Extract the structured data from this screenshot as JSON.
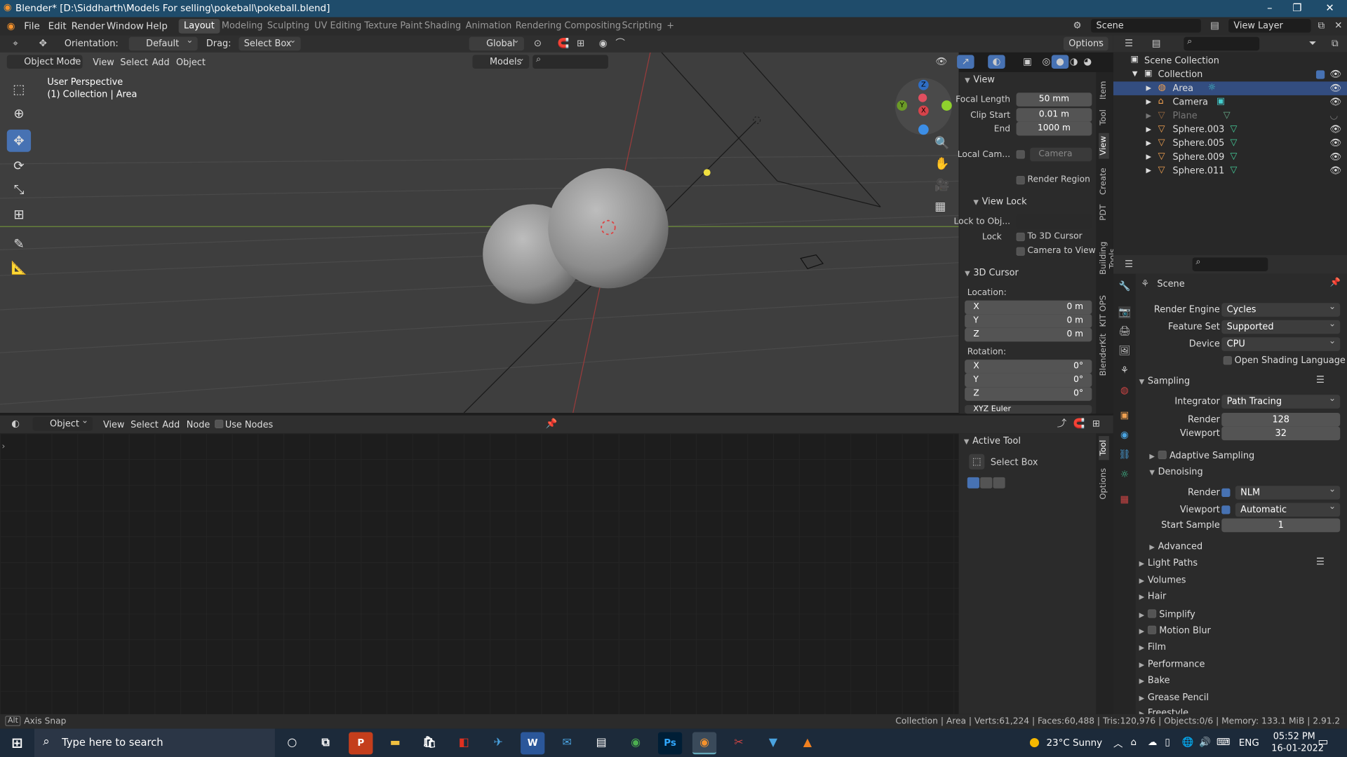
{
  "window": {
    "title": "Blender* [D:\\Siddharth\\Models For selling\\pokeball\\pokeball.blend]"
  },
  "menu": {
    "items": [
      "File",
      "Edit",
      "Render",
      "Window",
      "Help"
    ]
  },
  "workspaces": [
    "Layout",
    "Modeling",
    "Sculpting",
    "UV Editing",
    "Texture Paint",
    "Shading",
    "Animation",
    "Rendering",
    "Compositing",
    "Scripting",
    "+"
  ],
  "scene_field": "Scene",
  "view_layer_field": "View Layer",
  "tool_header": {
    "orientation_label": "Orientation:",
    "orientation_value": "Default",
    "drag_label": "Drag:",
    "drag_value": "Select Box",
    "transform_orientation": "Global",
    "options": "Options"
  },
  "viewport_header": {
    "mode": "Object Mode",
    "menus": [
      "View",
      "Select",
      "Add",
      "Object"
    ],
    "collection": "Models"
  },
  "viewport": {
    "overlay_line1": "User Perspective",
    "overlay_line2": "(1) Collection | Area",
    "gizmo_axes": [
      "Z",
      "Y",
      "X"
    ]
  },
  "npanel": {
    "view_section": "View",
    "focal_length_label": "Focal Length",
    "focal_length": "50 mm",
    "clip_start_label": "Clip Start",
    "clip_start": "0.01 m",
    "end_label": "End",
    "clip_end": "1000 m",
    "local_cam_label": "Local Cam...",
    "local_cam_value": "Camera",
    "render_region": "Render Region",
    "view_lock_section": "View Lock",
    "lock_to_obj_label": "Lock to Obj...",
    "lock_label": "Lock",
    "to_3d_cursor": "To 3D Cursor",
    "camera_to_view": "Camera to View",
    "cursor_section": "3D Cursor",
    "location_label": "Location:",
    "loc": [
      {
        "axis": "X",
        "value": "0 m"
      },
      {
        "axis": "Y",
        "value": "0 m"
      },
      {
        "axis": "Z",
        "value": "0 m"
      }
    ],
    "rotation_label": "Rotation:",
    "rot": [
      {
        "axis": "X",
        "value": "0°"
      },
      {
        "axis": "Y",
        "value": "0°"
      },
      {
        "axis": "Z",
        "value": "0°"
      }
    ],
    "rotation_mode": "XYZ Euler",
    "tabs": [
      "Item",
      "Tool",
      "View",
      "Create",
      "PDT",
      "Building Tools",
      "KIT OPS",
      "BlenderKit"
    ]
  },
  "node_header": {
    "type": "Object",
    "menus": [
      "View",
      "Select",
      "Add",
      "Node"
    ],
    "use_nodes": "Use Nodes"
  },
  "active_tool": {
    "section": "Active Tool",
    "name": "Select Box",
    "tabs": [
      "Tool",
      "Options"
    ]
  },
  "outliner": {
    "root": "Scene Collection",
    "collection": "Collection",
    "items": [
      "Area",
      "Camera",
      "Plane",
      "Sphere.003",
      "Sphere.005",
      "Sphere.009",
      "Sphere.011"
    ]
  },
  "properties": {
    "title": "Scene",
    "render_engine_label": "Render Engine",
    "render_engine": "Cycles",
    "feature_set_label": "Feature Set",
    "feature_set": "Supported",
    "device_label": "Device",
    "device": "CPU",
    "osl": "Open Shading Language",
    "sampling": "Sampling",
    "integrator_label": "Integrator",
    "integrator": "Path Tracing",
    "render_label": "Render",
    "render_samples": "128",
    "viewport_label": "Viewport",
    "viewport_samples": "32",
    "adaptive": "Adaptive Sampling",
    "denoising": "Denoising",
    "den_render_label": "Render",
    "den_render": "NLM",
    "den_viewport_label": "Viewport",
    "den_viewport": "Automatic",
    "start_sample_label": "Start Sample",
    "start_sample": "1",
    "advanced": "Advanced",
    "light_paths": "Light Paths",
    "volumes": "Volumes",
    "hair": "Hair",
    "simplify": "Simplify",
    "motion_blur": "Motion Blur",
    "film": "Film",
    "performance": "Performance",
    "bake": "Bake",
    "grease_pencil": "Grease Pencil",
    "freestyle": "Freestyle"
  },
  "status": {
    "left": "Axis Snap",
    "right": "Collection | Area | Verts:61,224 | Faces:60,488 | Tris:120,976 | Objects:0/6 | Memory: 133.1 MiB | 2.91.2",
    "alt": "Alt"
  },
  "taskbar": {
    "search_placeholder": "Type here to search",
    "weather": "23°C  Sunny",
    "lang": "ENG",
    "time": "05:52 PM",
    "date": "16-01-2022"
  }
}
